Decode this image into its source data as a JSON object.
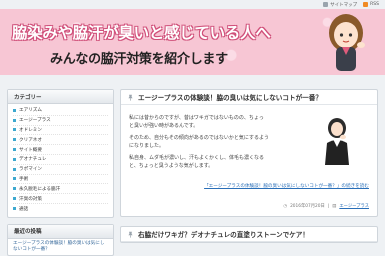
{
  "topbar": {
    "sitemap_label": "サイトマップ",
    "rss_label": "RSS"
  },
  "header": {
    "title": "脇染みや脇汗が臭いと感じている人へ",
    "subtitle": "みんなの脇汗対策を紹介します"
  },
  "sidebar": {
    "category_heading": "カテゴリー",
    "categories": [
      "エアリズム",
      "エージープラス",
      "オドレミン",
      "クリアネオ",
      "サイト概要",
      "デオナチュレ",
      "ラポマイン",
      "手術",
      "永久脱毛による脇汗",
      "汗臭の対策",
      "通話"
    ],
    "recent_heading": "最近の投稿",
    "recent_posts": [
      "エージープラスの体験談！脇の臭いは気にしないコトが一番？"
    ]
  },
  "posts": [
    {
      "title": "エージープラスの体験談！脇の臭いは気にしないコトが一番？",
      "lines": [
        "私には昔からのですが、昔はワキガではないものの、ちょっ",
        "と臭いが強い時があるんです。",
        "",
        "そのため、自分もその傾向があるのではないかと気にするよう",
        "になりました。",
        "",
        "私自身、ムダ毛が濃いし、汗もよくかくし、体毛も濃くなる",
        "と、ちょっと臭うような気がします。"
      ],
      "more_link": "「エージープラスの体験談！脇の臭いは気にしないコトが一番？」の続きを読む",
      "date": "2016年07月20日",
      "meta_sep": "|",
      "meta_category": "エージープラス"
    },
    {
      "title": "右脇だけワキガ？デオナチュレの直塗りストーンでケア！"
    }
  ],
  "colors": {
    "header_bg": "#f7c6d4",
    "title_outline": "#d0507a",
    "accent_blue": "#3da8cf",
    "link": "#2a6fb8"
  }
}
